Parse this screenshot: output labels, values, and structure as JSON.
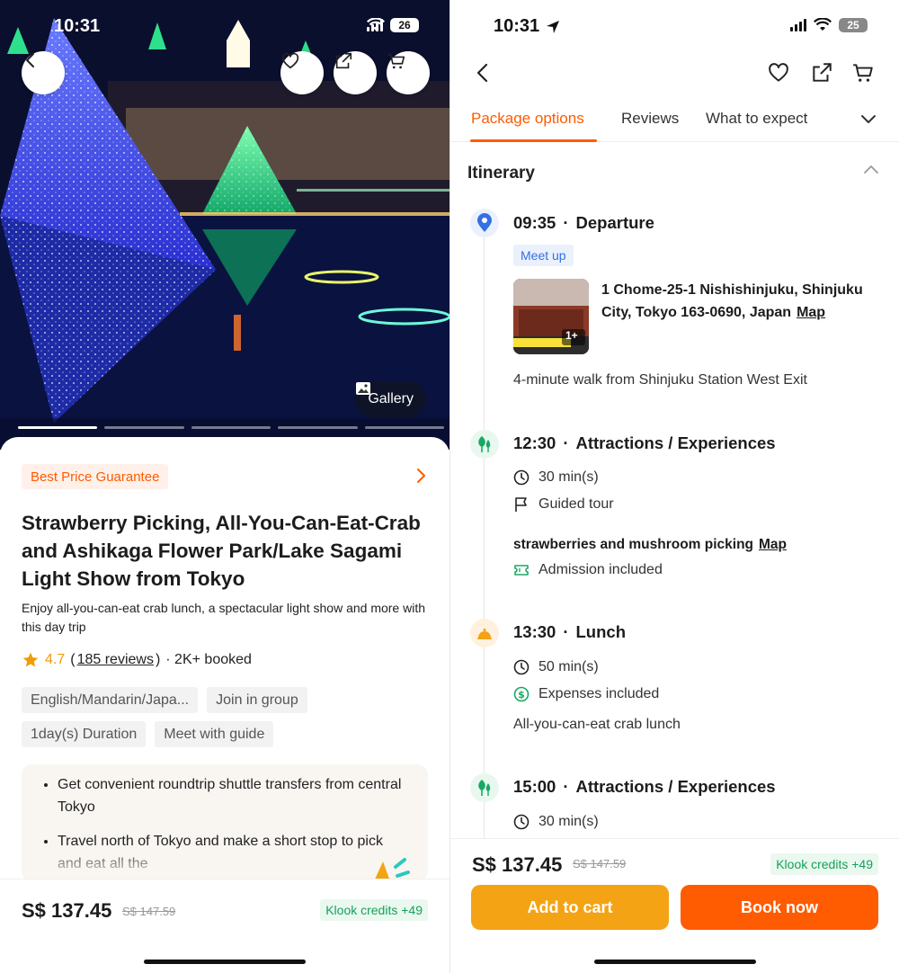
{
  "left": {
    "status": {
      "time": "10:31",
      "battery": "26"
    },
    "gallery_label": "Gallery",
    "best_price": "Best Price Guarantee",
    "title": "Strawberry Picking, All-You-Can-Eat-Crab and Ashikaga Flower Park/Lake Sagami Light Show from Tokyo",
    "subtitle": "Enjoy all-you-can-eat crab lunch, a spectacular light show and more with this day trip",
    "rating": {
      "score": "4.7",
      "open": "(",
      "reviews": "185 reviews",
      "close": ")",
      "booked": "· 2K+ booked"
    },
    "chips": [
      "English/Mandarin/Japa...",
      "Join in group",
      "1day(s) Duration",
      "Meet with guide"
    ],
    "highlights": [
      "Get convenient roundtrip shuttle transfers from central Tokyo",
      "Travel north of Tokyo and make a short stop to pick and eat all the"
    ],
    "price": "S$ 137.45",
    "old_price": "S$ 147.59",
    "credits": "Klook credits +49"
  },
  "right": {
    "status": {
      "time": "10:31",
      "battery": "25"
    },
    "tabs": [
      "Package options",
      "Reviews",
      "What to expect"
    ],
    "itinerary_title": "Itinerary",
    "steps": [
      {
        "time": "09:35",
        "dot": "·",
        "label": "Departure"
      },
      {
        "time": "12:30",
        "dot": "·",
        "label": "Attractions / Experiences"
      },
      {
        "time": "13:30",
        "dot": "·",
        "label": "Lunch"
      },
      {
        "time": "15:00",
        "dot": "·",
        "label": "Attractions / Experiences"
      }
    ],
    "meetup": "Meet up",
    "thumb_badge": "1+",
    "address": "1 Chome-25-1 Nishishinjuku, Shinjuku City, Tokyo 163-0690, Japan",
    "map_label": "Map",
    "walk_note": "4-minute walk from Shinjuku Station West Exit",
    "step2": {
      "duration": "30 min(s)",
      "tour": "Guided tour",
      "activity": "strawberries and mushroom picking",
      "admission": "Admission included"
    },
    "step3": {
      "duration": "50 min(s)",
      "expenses": "Expenses included",
      "note": "All-you-can-eat crab lunch"
    },
    "step4": {
      "duration": "30 min(s)"
    },
    "price": "S$ 137.45",
    "old_price": "S$ 147.59",
    "credits": "Klook credits +49",
    "add_to_cart": "Add to cart",
    "book_now": "Book now"
  },
  "colors": {
    "accent": "#ff5b00",
    "cart": "#f4a315",
    "credits_green": "#16a05c",
    "meetup_blue": "#3470e3",
    "star": "#f09b0a"
  },
  "icons": [
    "back-arrow-icon",
    "heart-icon",
    "share-icon",
    "cart-icon",
    "image-icon",
    "chevron-right-icon",
    "chevron-down-icon",
    "chevron-up-icon",
    "location-pin-icon",
    "tree-icon",
    "bell-icon",
    "clock-icon",
    "flag-icon",
    "ticket-icon",
    "dollar-icon",
    "star-icon",
    "signal-icon",
    "wifi-icon",
    "location-arrow-icon"
  ]
}
